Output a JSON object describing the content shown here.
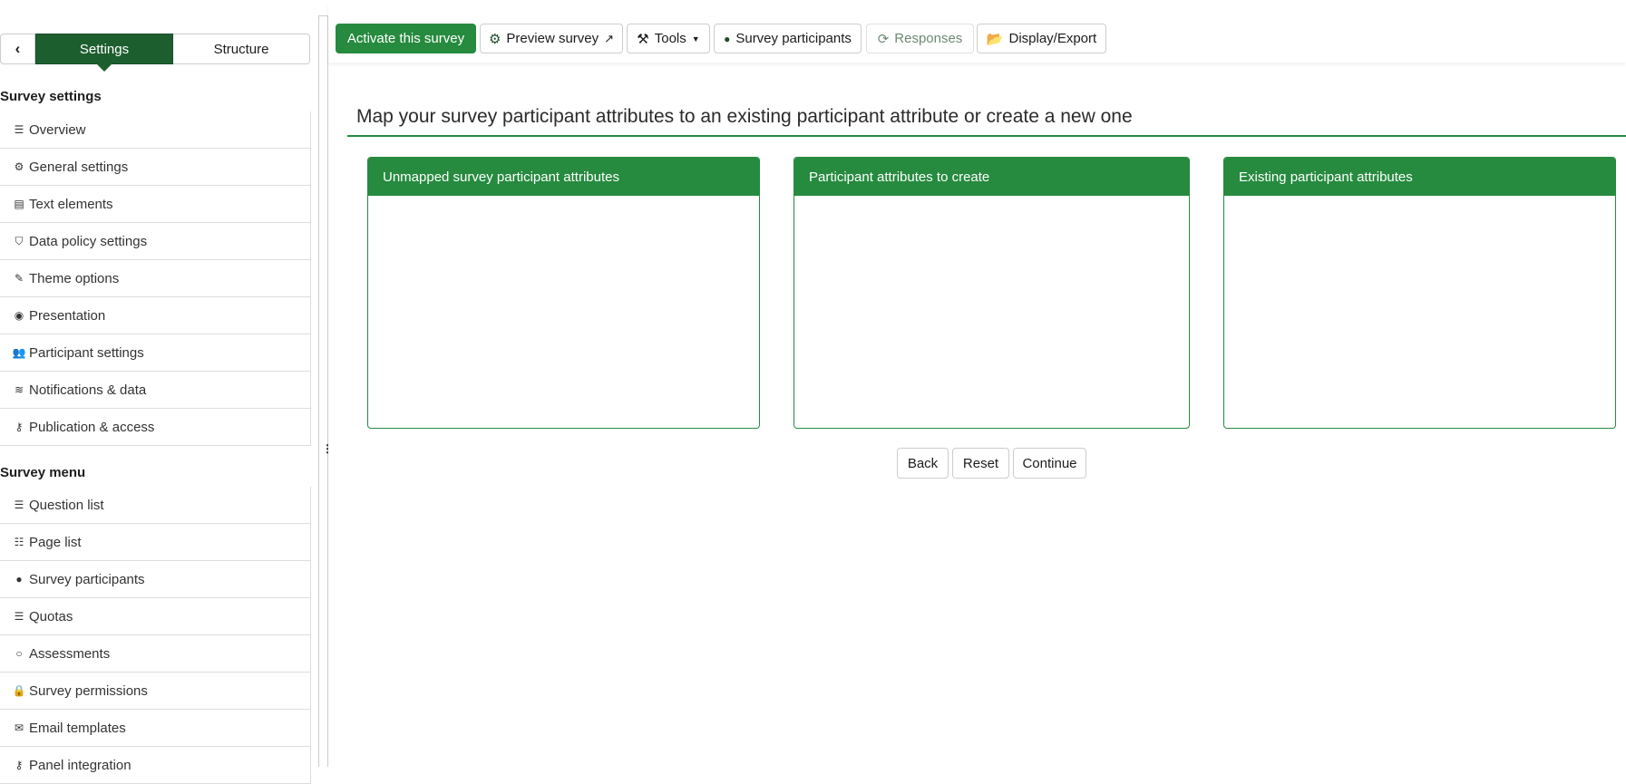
{
  "sidebar": {
    "tabs": {
      "settings": "Settings",
      "structure": "Structure"
    },
    "settings_header": "Survey settings",
    "settings_items": [
      {
        "label": "Overview",
        "icon": "list-icon",
        "glyph": "☰"
      },
      {
        "label": "General settings",
        "icon": "cogs-icon",
        "glyph": "⚙"
      },
      {
        "label": "Text elements",
        "icon": "file-text-icon",
        "glyph": "▤"
      },
      {
        "label": "Data policy settings",
        "icon": "shield-icon",
        "glyph": "⛉"
      },
      {
        "label": "Theme options",
        "icon": "paint-brush-icon",
        "glyph": "✎"
      },
      {
        "label": "Presentation",
        "icon": "eye-slash-icon",
        "glyph": "◉"
      },
      {
        "label": "Participant settings",
        "icon": "users-icon",
        "glyph": "👥"
      },
      {
        "label": "Notifications & data",
        "icon": "rss-icon",
        "glyph": "≋"
      },
      {
        "label": "Publication & access",
        "icon": "key-icon",
        "glyph": "⚷"
      }
    ],
    "menu_header": "Survey menu",
    "menu_items": [
      {
        "label": "Question list",
        "icon": "list-icon",
        "glyph": "☰"
      },
      {
        "label": "Page list",
        "icon": "th-list-icon",
        "glyph": "☷"
      },
      {
        "label": "Survey participants",
        "icon": "user-icon",
        "glyph": "●"
      },
      {
        "label": "Quotas",
        "icon": "tasks-icon",
        "glyph": "☰"
      },
      {
        "label": "Assessments",
        "icon": "comment-icon",
        "glyph": "○"
      },
      {
        "label": "Survey permissions",
        "icon": "lock-icon",
        "glyph": "🔒"
      },
      {
        "label": "Email templates",
        "icon": "envelope-icon",
        "glyph": "✉"
      },
      {
        "label": "Panel integration",
        "icon": "key-icon",
        "glyph": "⚷"
      }
    ]
  },
  "toolbar": {
    "activate": "Activate this survey",
    "preview": "Preview survey",
    "tools": "Tools",
    "participants": "Survey participants",
    "responses": "Responses",
    "export": "Display/Export"
  },
  "main": {
    "heading": "Map your survey participant attributes to an existing participant attribute or create a new one",
    "panels": [
      "Unmapped survey participant attributes",
      "Participant attributes to create",
      "Existing participant attributes"
    ],
    "buttons": {
      "back": "Back",
      "reset": "Reset",
      "continue": "Continue"
    }
  },
  "colors": {
    "primary": "#268a3f",
    "active_tab": "#1d5e2f"
  }
}
